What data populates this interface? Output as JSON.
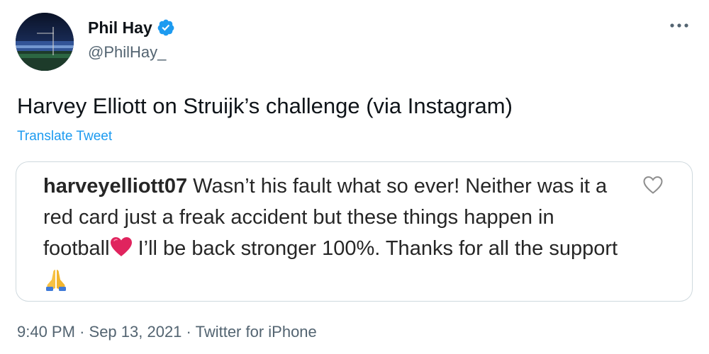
{
  "author": {
    "display_name": "Phil Hay",
    "handle": "@PhilHay_",
    "verified": true,
    "avatar": "stadium-photo-avatar"
  },
  "tweet": {
    "text": "Harvey Elliott on Struijk’s challenge (via Instagram)",
    "translate_label": "Translate Tweet"
  },
  "quote": {
    "username": "harveyelliott07",
    "comment_part1": " Wasn’t his fault what so ever! Neither was it a red card just a freak accident but these things happen in football",
    "comment_part2": " I’ll be back stronger 100%. Thanks for all the support ",
    "emojis": [
      "red-heart-icon",
      "folded-hands-icon"
    ],
    "like_icon": "heart-outline-icon"
  },
  "meta": {
    "time": "9:40 PM",
    "separator": "·",
    "date": "Sep 13, 2021",
    "source": "Twitter for iPhone"
  },
  "icons": {
    "more": "more-dots-icon",
    "verified": "verified-badge-icon"
  },
  "colors": {
    "link": "#1d9bf0",
    "secondary_text": "#536471",
    "primary_text": "#0f1419",
    "border": "#cfd9de",
    "verified": "#1d9bf0",
    "heart": "#e0245e"
  }
}
